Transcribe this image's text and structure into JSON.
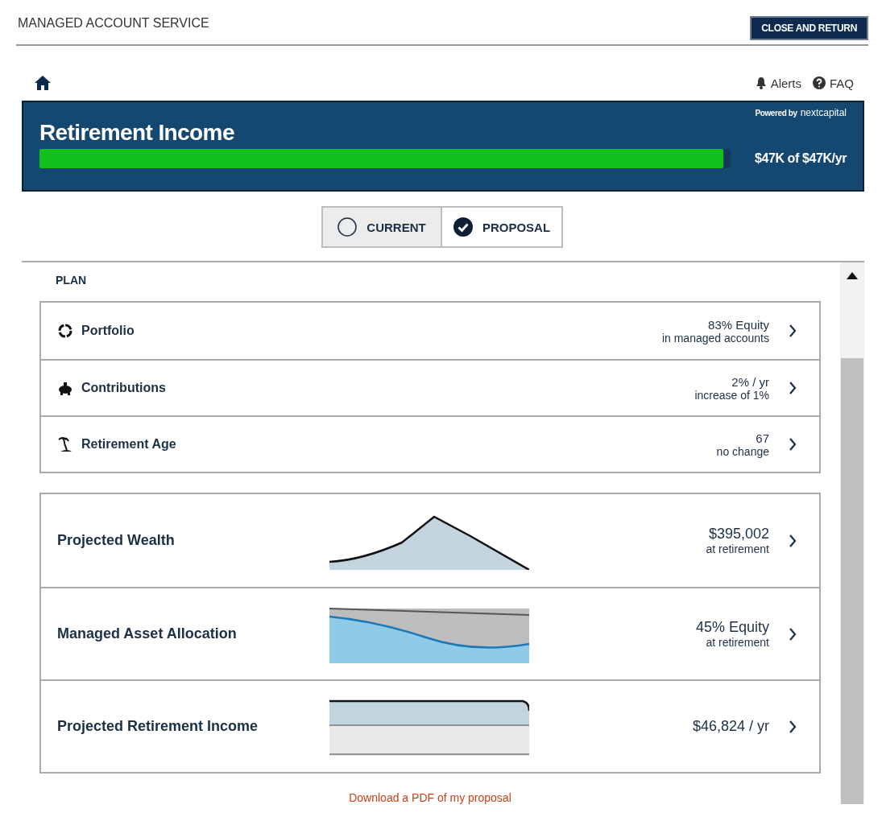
{
  "header": {
    "title": "MANAGED ACCOUNT SERVICE",
    "close_button": "CLOSE AND RETURN"
  },
  "nav": {
    "links": [
      {
        "kind": "alerts",
        "label": "Alerts"
      },
      {
        "kind": "faq",
        "label": "FAQ"
      }
    ]
  },
  "banner": {
    "title": "Retirement Income",
    "powered_by": "Powered by",
    "brand": "nextcapital",
    "progress": {
      "level": 0.99
    },
    "reading": "$47K of $47K/yr"
  },
  "toggle": [
    {
      "label": "CURRENT",
      "selected": false
    },
    {
      "label": "PROPOSAL",
      "selected": true
    }
  ],
  "plan": {
    "label": "PLAN",
    "items": [
      {
        "kind": "portfolio",
        "label": "Portfolio",
        "value": "83% Equity",
        "sub": "in managed accounts"
      },
      {
        "kind": "contributions",
        "label": "Contributions",
        "value": "2% / yr",
        "sub": "increase of 1%"
      },
      {
        "kind": "retirement",
        "label": "Retirement Age",
        "value": "67",
        "sub": "no change"
      }
    ]
  },
  "metrics": [
    {
      "kind": "wealth",
      "label": "Projected Wealth",
      "value": "$395,002",
      "sub": "at retirement"
    },
    {
      "kind": "allocation",
      "label": "Managed Asset Allocation",
      "value": "45% Equity",
      "sub": "at retirement"
    },
    {
      "kind": "income",
      "label": "Projected Retirement Income",
      "value": "$46,824 / yr"
    }
  ],
  "download_link": "Download a PDF of my proposal"
}
